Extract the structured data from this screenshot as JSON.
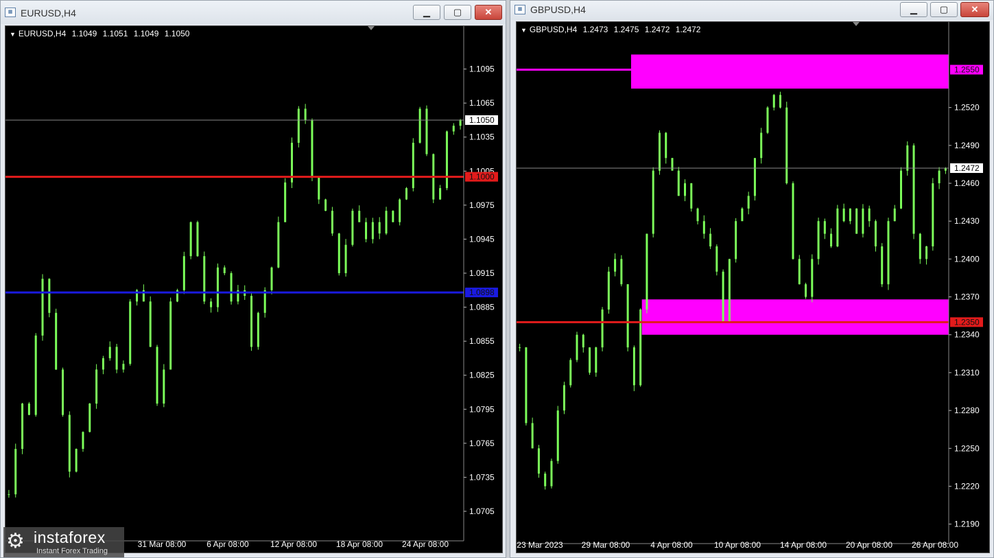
{
  "windows": [
    {
      "id": "eurusd",
      "title": "EURUSD,H4",
      "controls": {
        "minimize": "▁",
        "maximize": "▢",
        "close": "✕"
      },
      "info": {
        "symbol": "EURUSD,H4",
        "open": "1.1049",
        "high": "1.1051",
        "low": "1.1049",
        "close": "1.1050"
      },
      "price_axis": [
        "1.1095",
        "1.1065",
        "1.1035",
        "1.1005",
        "1.0975",
        "1.0945",
        "1.0915",
        "1.0885",
        "1.0855",
        "1.0825",
        "1.0795",
        "1.0765",
        "1.0735",
        "1.0705"
      ],
      "time_axis": [
        "31 Mar 08:00",
        "6 Apr 08:00",
        "12 Apr 08:00",
        "18 Apr 08:00",
        "24 Apr 08:00"
      ],
      "price_range": [
        1.0685,
        1.1122
      ],
      "current_price": {
        "value": 1.105,
        "label": "1.1050",
        "color": "#ffffff"
      },
      "hlines": [
        {
          "name": "resistance-line",
          "value": 1.1,
          "label": "1.1000",
          "color": "#e31b1b"
        },
        {
          "name": "support-line",
          "value": 1.0898,
          "label": "1.0898",
          "color": "#1a1ae0"
        }
      ],
      "zones": [],
      "series_color": "#7cff5a",
      "close_series": [
        1.072,
        1.076,
        1.08,
        1.079,
        1.086,
        1.091,
        1.088,
        1.083,
        1.079,
        1.074,
        1.076,
        1.0775,
        1.08,
        1.083,
        1.084,
        1.085,
        1.083,
        1.0835,
        1.089,
        1.09,
        1.089,
        1.085,
        1.08,
        1.083,
        1.089,
        1.09,
        1.093,
        1.096,
        1.093,
        1.089,
        1.0885,
        1.092,
        1.0915,
        1.089,
        1.09,
        1.0895,
        1.085,
        1.088,
        1.09,
        1.092,
        1.096,
        1.0995,
        1.103,
        1.106,
        1.105,
        1.1,
        1.098,
        1.097,
        1.095,
        1.0915,
        1.094,
        1.097,
        1.096,
        1.0945,
        1.096,
        1.095,
        1.097,
        1.096,
        1.098,
        1.099,
        1.103,
        1.106,
        1.102,
        1.098,
        1.099,
        1.104,
        1.1045,
        1.105
      ]
    },
    {
      "id": "gbpusd",
      "title": "GBPUSD,H4",
      "controls": {
        "minimize": "▁",
        "maximize": "▢",
        "close": "✕"
      },
      "info": {
        "symbol": "GBPUSD,H4",
        "open": "1.2473",
        "high": "1.2475",
        "low": "1.2472",
        "close": "1.2472"
      },
      "price_axis": [
        "1.2520",
        "1.2490",
        "1.2460",
        "1.2430",
        "1.2400",
        "1.2370",
        "1.2340",
        "1.2310",
        "1.2280",
        "1.2250",
        "1.2220",
        "1.2190"
      ],
      "time_axis": [
        "23 Mar 2023",
        "29 Mar 08:00",
        "4 Apr 08:00",
        "10 Apr 08:00",
        "14 Apr 08:00",
        "20 Apr 08:00",
        "26 Apr 08:00"
      ],
      "price_range": [
        1.218,
        1.2578
      ],
      "current_price": {
        "value": 1.2472,
        "label": "1.2472",
        "color": "#ffffff"
      },
      "hlines": [
        {
          "name": "level-line-top",
          "value": 1.255,
          "label": "1.2550",
          "color": "#ff00ff",
          "start": 0.0,
          "end": 0.27
        },
        {
          "name": "support-line",
          "value": 1.235,
          "label": "1.2350",
          "color": "#e31b1b"
        }
      ],
      "zones": [
        {
          "name": "supply-zone",
          "from": 1.2535,
          "to": 1.2562,
          "start": 0.265,
          "color": "#ff00ff"
        },
        {
          "name": "demand-zone",
          "from": 1.234,
          "to": 1.2368,
          "start": 0.29,
          "color": "#ff00ff"
        }
      ],
      "series_color": "#7cff5a",
      "close_series": [
        1.233,
        1.227,
        1.225,
        1.223,
        1.222,
        1.224,
        1.228,
        1.23,
        1.232,
        1.234,
        1.233,
        1.231,
        1.233,
        1.236,
        1.239,
        1.24,
        1.238,
        1.233,
        1.23,
        1.236,
        1.242,
        1.247,
        1.25,
        1.248,
        1.247,
        1.245,
        1.246,
        1.244,
        1.243,
        1.242,
        1.241,
        1.239,
        1.235,
        1.24,
        1.243,
        1.244,
        1.245,
        1.248,
        1.25,
        1.252,
        1.253,
        1.252,
        1.246,
        1.24,
        1.238,
        1.237,
        1.24,
        1.243,
        1.242,
        1.241,
        1.244,
        1.243,
        1.244,
        1.242,
        1.244,
        1.243,
        1.241,
        1.238,
        1.243,
        1.244,
        1.247,
        1.249,
        1.242,
        1.24,
        1.241,
        1.246,
        1.247,
        1.2472
      ]
    }
  ],
  "watermark": {
    "brand": "instaforex",
    "slogan": "Instant Forex Trading",
    "icon": "gear-logo-icon"
  }
}
